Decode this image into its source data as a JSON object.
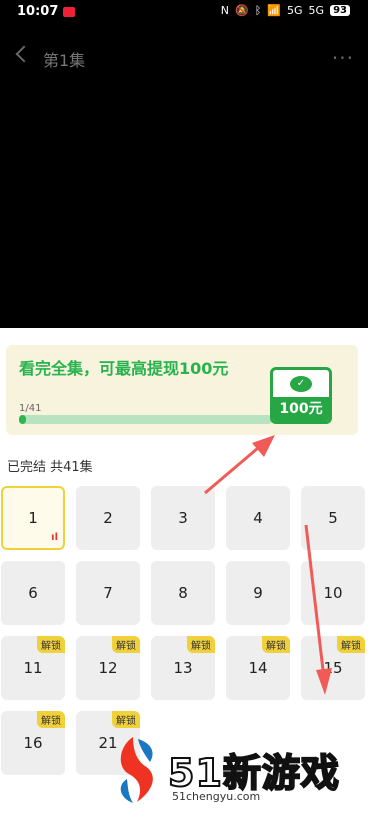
{
  "status_bar": {
    "time": "10:07",
    "battery": "93",
    "network_1": "5G",
    "network_2": "5G"
  },
  "nav": {
    "title": "第1集",
    "more": "···"
  },
  "banner": {
    "title": "看完全集，可最高提现100元",
    "progress_text": "1/41",
    "progress_fraction": 0.024,
    "reward_label": "100元",
    "colors": {
      "accent": "#27b34e",
      "background": "#f7f3dc"
    }
  },
  "series_status": "已完结 共41集",
  "episodes": [
    {
      "number": "1",
      "locked": false,
      "active": true
    },
    {
      "number": "2",
      "locked": false
    },
    {
      "number": "3",
      "locked": false
    },
    {
      "number": "4",
      "locked": false
    },
    {
      "number": "5",
      "locked": false
    },
    {
      "number": "6",
      "locked": false
    },
    {
      "number": "7",
      "locked": false
    },
    {
      "number": "8",
      "locked": false
    },
    {
      "number": "9",
      "locked": false
    },
    {
      "number": "10",
      "locked": false
    },
    {
      "number": "11",
      "locked": true,
      "badge": "解锁"
    },
    {
      "number": "12",
      "locked": true,
      "badge": "解锁"
    },
    {
      "number": "13",
      "locked": true,
      "badge": "解锁"
    },
    {
      "number": "14",
      "locked": true,
      "badge": "解锁"
    },
    {
      "number": "15",
      "locked": true,
      "badge": "解锁"
    },
    {
      "number": "16",
      "locked": true,
      "badge": "解锁"
    },
    {
      "number": "21",
      "locked": true,
      "badge": "解锁"
    }
  ],
  "watermark": {
    "brand": "51新游戏",
    "url": "51chengyu.com"
  }
}
